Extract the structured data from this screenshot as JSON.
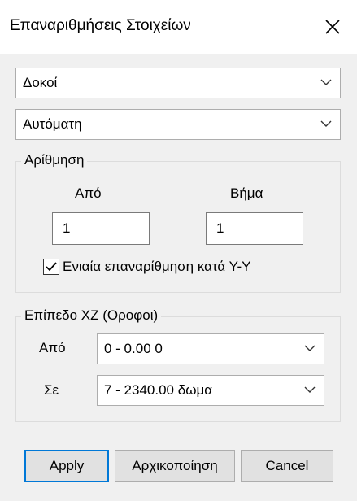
{
  "window": {
    "title": "Επαναριθμήσεις Στοιχείων"
  },
  "type_select": {
    "value": "Δοκοί"
  },
  "mode_select": {
    "value": "Αυτόματη"
  },
  "numbering": {
    "group_title": "Αρίθμηση",
    "from_label": "Από",
    "step_label": "Βήμα",
    "from_value": "1",
    "step_value": "1",
    "uniform_checkbox": {
      "label": "Ενιαία επαναρίθμηση κατά Υ-Υ",
      "checked": true
    }
  },
  "floors": {
    "group_title": "Επίπεδο  XZ (Οροφοι)",
    "from_label": "Από",
    "from_value": "0 - 0.00 0",
    "to_label": "Σε",
    "to_value": "7 - 2340.00 δωμα"
  },
  "buttons": {
    "apply": "Apply",
    "reset": "Αρχικοποίηση",
    "cancel": "Cancel"
  },
  "colors": {
    "accent": "#0078d7",
    "dialog_bg": "#f0f0f0",
    "title_bg": "#ffffff"
  },
  "icons": {
    "close": "close-icon",
    "dropdown": "chevron-down-icon",
    "check": "checkmark-icon"
  }
}
